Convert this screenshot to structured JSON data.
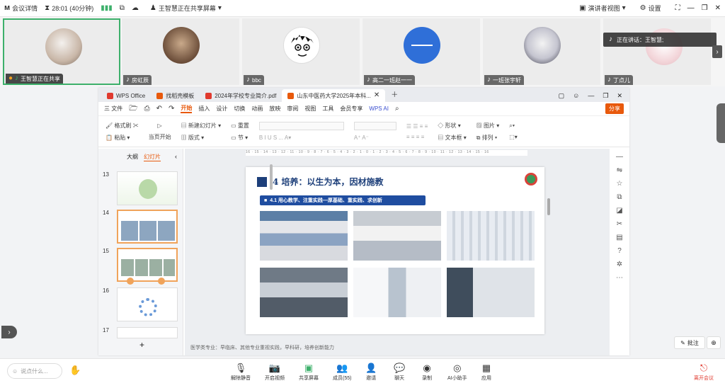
{
  "topbar": {
    "meeting_details": "会议详情",
    "timer": "28:01 (40分钟)",
    "sharing_status": "王智慧正在共享屏幕",
    "speaker_view": "演讲者视图",
    "settings": "设置"
  },
  "participants": [
    {
      "name": "王智慧正在共享",
      "active": true
    },
    {
      "name": "房虹辰"
    },
    {
      "name": "bbc"
    },
    {
      "name": "高二一班赵一一"
    },
    {
      "name": "一班张宇轩"
    },
    {
      "name": "丁点儿"
    }
  ],
  "speaking_now": "正在讲话：王智慧;",
  "wps": {
    "tabs": [
      "WPS Office",
      "找稻壳模板",
      "2024年学校专业简介.pdf",
      "山东中医药大学2025年本科..."
    ],
    "menu": [
      "三 文件",
      "开始",
      "插入",
      "设计",
      "切换",
      "动画",
      "放映",
      "审阅",
      "视图",
      "工具",
      "会员专享",
      "WPS AI"
    ],
    "share_label": "分享",
    "ribbon": {
      "format_brush": "格式刷",
      "paste": "粘贴",
      "from_current": "当页开始",
      "new_slide": "新建幻灯片",
      "layout": "版式",
      "reset": "重置",
      "section": "节",
      "shape": "形状",
      "image": "图片",
      "textbox": "文本框",
      "arrange": "排列"
    },
    "panel_tabs": [
      "大纲",
      "幻灯片"
    ],
    "slide_numbers": [
      "13",
      "14",
      "15",
      "16",
      "17"
    ],
    "ruler": "16 · 15 · 14 · 13 · 12 · 11 · 10 · 9 · 8 · 7 · 6 · 5 · 4 · 3 · 2 · 1 · 0 · 1 · 2 · 3 · 4 · 5 · 6 · 7 · 8 · 9 · 10 · 11 · 12 · 13 · 14 · 15 · 16",
    "slide": {
      "title": "4 培养：以生为本，因材施教",
      "subtitle": "4.1 用心教学、注重实践—厚基础、重实践、求创新"
    },
    "notes": "医学类专业：早临床、其他专业重视实践，早科研，培养创新能力"
  },
  "annotate": "批注",
  "bottom": {
    "chat_placeholder": "说点什么...",
    "buttons": [
      "解除静音",
      "开启视频",
      "共享屏幕",
      "成员(55)",
      "邀请",
      "聊天",
      "录制",
      "AI小助手",
      "应用"
    ],
    "leave": "离开会议"
  },
  "colors": {
    "accent": "#e8590c",
    "active_border": "#3db06b",
    "title_blue": "#1d3f7a",
    "leave_red": "#e03a2f"
  }
}
